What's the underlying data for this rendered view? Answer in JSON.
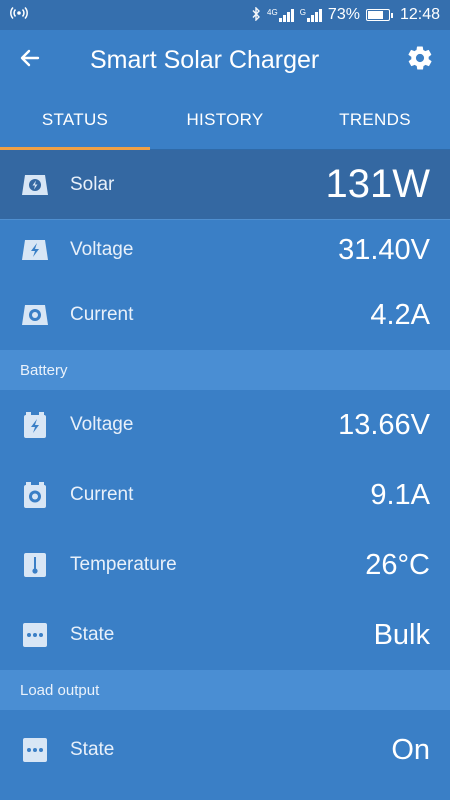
{
  "statusbar": {
    "left_icon": "hotspot-icon",
    "bluetooth": "✱",
    "net1": "4G",
    "net2": "G",
    "battery_percent": "73%",
    "battery_level": 0.73,
    "time": "12:48"
  },
  "appbar": {
    "title": "Smart Solar Charger",
    "back_icon": "back-arrow-icon",
    "settings_icon": "gear-icon"
  },
  "tabs": [
    {
      "label": "STATUS",
      "active": true
    },
    {
      "label": "HISTORY",
      "active": false
    },
    {
      "label": "TRENDS",
      "active": false
    }
  ],
  "solar": {
    "power": {
      "label": "Solar",
      "value": "131W",
      "icon": "solar-panel-icon"
    },
    "voltage": {
      "label": "Voltage",
      "value": "31.40V",
      "icon": "voltage-icon"
    },
    "current": {
      "label": "Current",
      "value": "4.2A",
      "icon": "current-icon"
    }
  },
  "battery": {
    "section_label": "Battery",
    "voltage": {
      "label": "Voltage",
      "value": "13.66V",
      "icon": "battery-voltage-icon"
    },
    "current": {
      "label": "Current",
      "value": "9.1A",
      "icon": "battery-current-icon"
    },
    "temperature": {
      "label": "Temperature",
      "value": "26°C",
      "icon": "thermometer-icon"
    },
    "state": {
      "label": "State",
      "value": "Bulk",
      "icon": "more-icon"
    }
  },
  "load": {
    "section_label": "Load output",
    "state": {
      "label": "State",
      "value": "On",
      "icon": "more-icon"
    }
  },
  "colors": {
    "background": "#3a7fc6",
    "statusbar": "#356fae",
    "highlight_row": "#3468a2",
    "section_header": "#4a8ed3",
    "tab_indicator": "#f0a044"
  }
}
